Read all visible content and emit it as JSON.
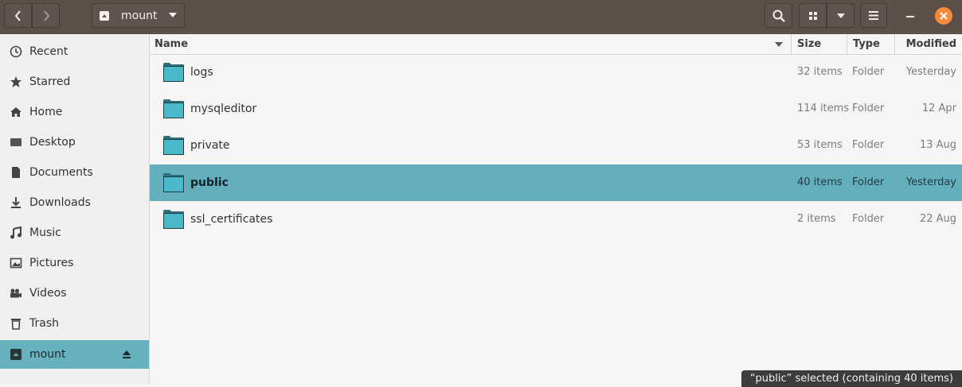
{
  "header": {
    "location": "mount",
    "back_icon": "chevron-left-icon",
    "forward_icon": "chevron-right-icon",
    "search_icon": "search-icon",
    "grid_icon": "grid-view-icon",
    "view_menu_icon": "chevron-down-icon",
    "menu_icon": "hamburger-menu-icon",
    "minimize_icon": "minimize-icon",
    "close_icon": "close-icon"
  },
  "sidebar": {
    "items": [
      {
        "label": "Recent",
        "icon": "clock-icon"
      },
      {
        "label": "Starred",
        "icon": "star-icon"
      },
      {
        "label": "Home",
        "icon": "home-icon"
      },
      {
        "label": "Desktop",
        "icon": "desktop-icon"
      },
      {
        "label": "Documents",
        "icon": "document-icon"
      },
      {
        "label": "Downloads",
        "icon": "download-icon"
      },
      {
        "label": "Music",
        "icon": "music-icon"
      },
      {
        "label": "Pictures",
        "icon": "picture-icon"
      },
      {
        "label": "Videos",
        "icon": "video-icon"
      },
      {
        "label": "Trash",
        "icon": "trash-icon"
      },
      {
        "label": "mount",
        "icon": "drive-icon",
        "active": true
      }
    ]
  },
  "columns": {
    "name": "Name",
    "size": "Size",
    "type": "Type",
    "modified": "Modified"
  },
  "files": [
    {
      "name": "logs",
      "size": "32 items",
      "type": "Folder",
      "modified": "Yesterday"
    },
    {
      "name": "mysqleditor",
      "size": "114 items",
      "type": "Folder",
      "modified": "12 Apr"
    },
    {
      "name": "private",
      "size": "53 items",
      "type": "Folder",
      "modified": "13 Aug"
    },
    {
      "name": "public",
      "size": "40 items",
      "type": "Folder",
      "modified": "Yesterday",
      "selected": true
    },
    {
      "name": "ssl_certificates",
      "size": "2 items",
      "type": "Folder",
      "modified": "22 Aug"
    }
  ],
  "status": "“public” selected  (containing 40 items)",
  "colors": {
    "header": "#5b5048",
    "selection": "#64afbc",
    "close": "#f58b3c",
    "folder": "#47b7c8"
  }
}
